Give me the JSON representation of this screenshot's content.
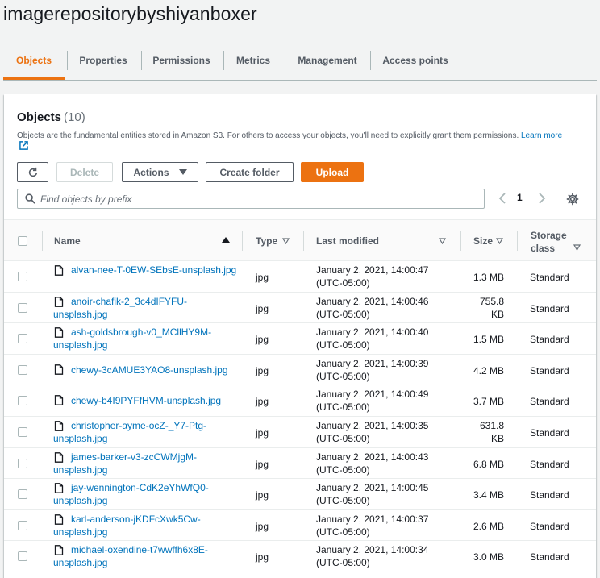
{
  "bucket": {
    "title": "imagerepositorybyshiyanboxer"
  },
  "tabs": [
    {
      "label": "Objects",
      "active": true
    },
    {
      "label": "Properties",
      "active": false
    },
    {
      "label": "Permissions",
      "active": false
    },
    {
      "label": "Metrics",
      "active": false
    },
    {
      "label": "Management",
      "active": false
    },
    {
      "label": "Access points",
      "active": false
    }
  ],
  "objects_panel": {
    "title": "Objects",
    "count": "(10)",
    "description": "Objects are the fundamental entities stored in Amazon S3. For others to access your objects, you'll need to explicitly grant them permissions.",
    "learn_more": "Learn more"
  },
  "toolbar": {
    "refresh_icon": "refresh-icon",
    "delete_label": "Delete",
    "actions_label": "Actions",
    "create_folder_label": "Create folder",
    "upload_label": "Upload"
  },
  "search": {
    "placeholder": "Find objects by prefix"
  },
  "pagination": {
    "current_page": "1"
  },
  "table": {
    "columns": {
      "name": "Name",
      "type": "Type",
      "last_modified": "Last modified",
      "size": "Size",
      "storage_class_line1": "Storage",
      "storage_class_line2": "class"
    },
    "rows": [
      {
        "name": "alvan-nee-T-0EW-SEbsE-unsplash.jpg",
        "type": "jpg",
        "modified_date": "January 2, 2021, 14:00:47",
        "modified_tz": "(UTC-05:00)",
        "size": "1.3 MB",
        "storage_class": "Standard"
      },
      {
        "name": "anoir-chafik-2_3c4dIFYFU-unsplash.jpg",
        "type": "jpg",
        "modified_date": "January 2, 2021, 14:00:46",
        "modified_tz": "(UTC-05:00)",
        "size": "755.8 KB",
        "storage_class": "Standard"
      },
      {
        "name": "ash-goldsbrough-v0_MCllHY9M-unsplash.jpg",
        "type": "jpg",
        "modified_date": "January 2, 2021, 14:00:40",
        "modified_tz": "(UTC-05:00)",
        "size": "1.5 MB",
        "storage_class": "Standard"
      },
      {
        "name": "chewy-3cAMUE3YAO8-unsplash.jpg",
        "type": "jpg",
        "modified_date": "January 2, 2021, 14:00:39",
        "modified_tz": "(UTC-05:00)",
        "size": "4.2 MB",
        "storage_class": "Standard"
      },
      {
        "name": "chewy-b4I9PYFfHVM-unsplash.jpg",
        "type": "jpg",
        "modified_date": "January 2, 2021, 14:00:49",
        "modified_tz": "(UTC-05:00)",
        "size": "3.7 MB",
        "storage_class": "Standard"
      },
      {
        "name": "christopher-ayme-ocZ-_Y7-Ptg-unsplash.jpg",
        "type": "jpg",
        "modified_date": "January 2, 2021, 14:00:35",
        "modified_tz": "(UTC-05:00)",
        "size": "631.8 KB",
        "storage_class": "Standard"
      },
      {
        "name": "james-barker-v3-zcCWMjgM-unsplash.jpg",
        "type": "jpg",
        "modified_date": "January 2, 2021, 14:00:43",
        "modified_tz": "(UTC-05:00)",
        "size": "6.8 MB",
        "storage_class": "Standard"
      },
      {
        "name": "jay-wennington-CdK2eYhWfQ0-unsplash.jpg",
        "type": "jpg",
        "modified_date": "January 2, 2021, 14:00:45",
        "modified_tz": "(UTC-05:00)",
        "size": "3.4 MB",
        "storage_class": "Standard"
      },
      {
        "name": "karl-anderson-jKDFcXwk5Cw-unsplash.jpg",
        "type": "jpg",
        "modified_date": "January 2, 2021, 14:00:37",
        "modified_tz": "(UTC-05:00)",
        "size": "2.6 MB",
        "storage_class": "Standard"
      },
      {
        "name": "michael-oxendine-t7wwffh6x8E-unsplash.jpg",
        "type": "jpg",
        "modified_date": "January 2, 2021, 14:00:34",
        "modified_tz": "(UTC-05:00)",
        "size": "3.0 MB",
        "storage_class": "Standard"
      }
    ]
  },
  "colors": {
    "accent": "#ec7211",
    "link": "#0073bb",
    "text": "#16191f",
    "muted": "#545b64"
  }
}
